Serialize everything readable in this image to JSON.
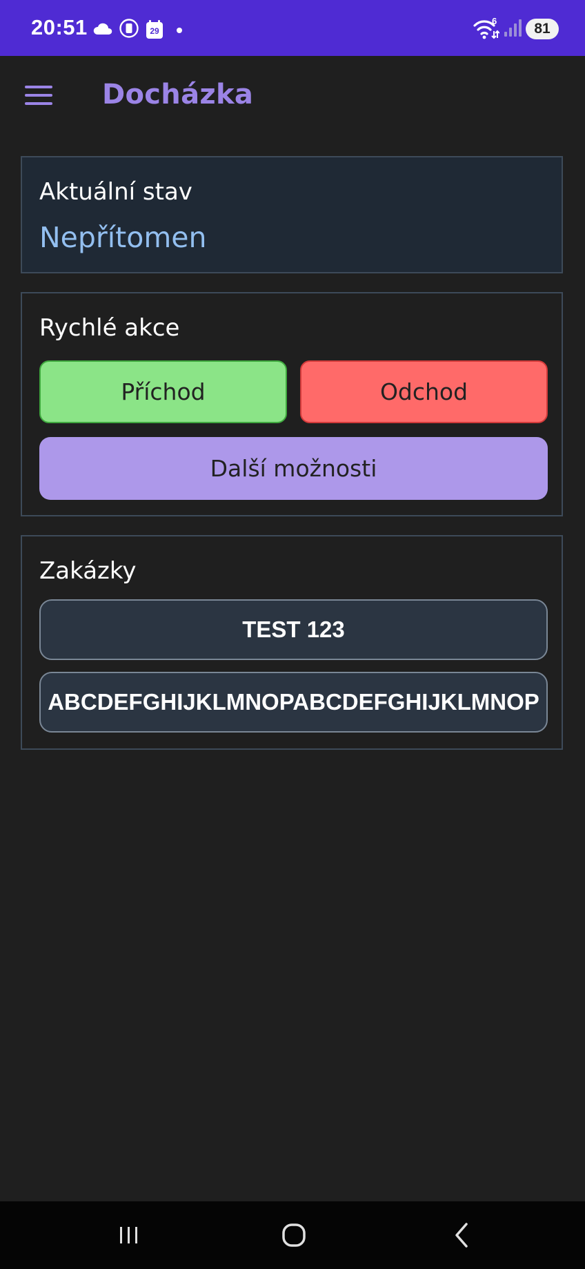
{
  "status_bar": {
    "time": "20:51",
    "calendar_day": "29",
    "wifi_badge": "6",
    "battery": "81"
  },
  "app_bar": {
    "title": "Docházka"
  },
  "current_status": {
    "title": "Aktuální stav",
    "value": "Nepřítomen"
  },
  "quick_actions": {
    "title": "Rychlé akce",
    "arrive_label": "Příchod",
    "leave_label": "Odchod",
    "more_label": "Další možnosti"
  },
  "jobs": {
    "title": "Zakázky",
    "items": [
      {
        "label": "TEST 123"
      },
      {
        "label": "ABCDEFGHIJKLMNOPABCDEFGHIJKLMNOP"
      }
    ]
  },
  "colors": {
    "status_bar": "#4f2bd3",
    "accent": "#9b84e6",
    "arrive": "#8be487",
    "leave": "#ff6a69",
    "more": "#ad98ea",
    "status_value": "#93bff0"
  },
  "icons": {
    "status_left": [
      "cloud-icon",
      "vibrate-icon",
      "calendar-icon",
      "dot-icon"
    ],
    "status_right": [
      "wifi-icon",
      "signal-icon",
      "battery-icon"
    ],
    "nav": [
      "recent-apps-icon",
      "home-icon",
      "back-icon"
    ]
  }
}
